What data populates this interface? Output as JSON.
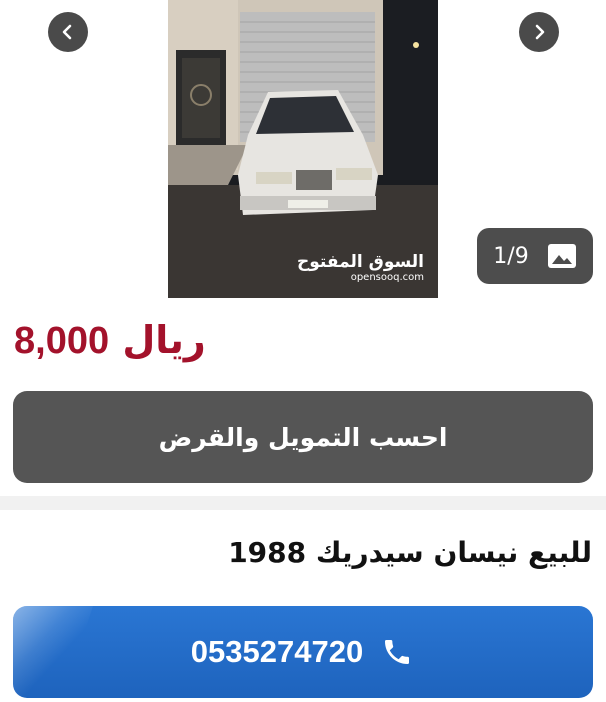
{
  "gallery": {
    "counter": "1/9",
    "watermark_ar": "السوق المفتوح",
    "watermark_en": "opensooq.com",
    "icons": {
      "prev": "chevron-left-icon",
      "next": "chevron-right-icon",
      "counter": "image-icon"
    }
  },
  "listing": {
    "price_amount": "8,000",
    "price_currency": "ريال",
    "title": "للبيع نيسان سيدريك 1988"
  },
  "actions": {
    "finance_label": "احسب التمويل والقرض",
    "phone_number": "0535274720",
    "phone_icon": "phone-icon"
  },
  "colors": {
    "price": "#a3122b",
    "finance_button": "#555555",
    "call_button": "#1e63bd"
  }
}
